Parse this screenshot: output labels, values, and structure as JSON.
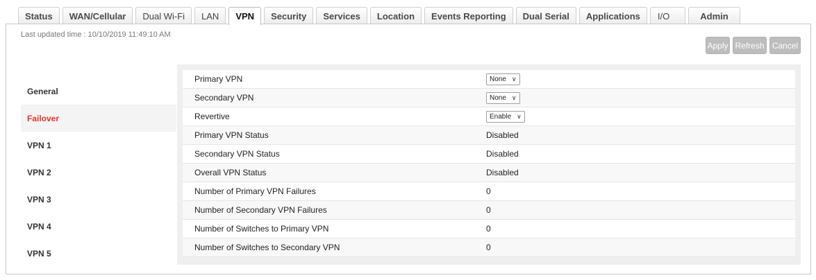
{
  "tabs": [
    {
      "label": "Status",
      "key": "status"
    },
    {
      "label": "WAN/Cellular",
      "key": "wan"
    },
    {
      "label": "Dual Wi-Fi",
      "key": "wifi"
    },
    {
      "label": "LAN",
      "key": "lan"
    },
    {
      "label": "VPN",
      "key": "vpn"
    },
    {
      "label": "Security",
      "key": "security"
    },
    {
      "label": "Services",
      "key": "services"
    },
    {
      "label": "Location",
      "key": "location"
    },
    {
      "label": "Events Reporting",
      "key": "events"
    },
    {
      "label": "Dual Serial",
      "key": "serial"
    },
    {
      "label": "Applications",
      "key": "apps"
    },
    {
      "label": "I/O",
      "key": "io"
    },
    {
      "label": "Admin",
      "key": "admin"
    }
  ],
  "active_tab": "VPN",
  "header": {
    "last_updated_label": "Last updated time :",
    "last_updated_value": "10/10/2019 11:49:10 AM"
  },
  "buttons": {
    "apply": "Apply",
    "refresh": "Refresh",
    "cancel": "Cancel"
  },
  "sidebar": {
    "items": [
      "General",
      "Failover",
      "VPN 1",
      "VPN 2",
      "VPN 3",
      "VPN 4",
      "VPN 5"
    ],
    "active": "Failover"
  },
  "form": {
    "rows": [
      {
        "label": "Primary VPN",
        "type": "select",
        "value": "None"
      },
      {
        "label": "Secondary VPN",
        "type": "select",
        "value": "None"
      },
      {
        "label": "Revertive",
        "type": "select",
        "value": "Enable"
      },
      {
        "label": "Primary VPN Status",
        "type": "text",
        "value": "Disabled"
      },
      {
        "label": "Secondary VPN Status",
        "type": "text",
        "value": "Disabled"
      },
      {
        "label": "Overall VPN Status",
        "type": "text",
        "value": "Disabled"
      },
      {
        "label": "Number of Primary VPN Failures",
        "type": "text",
        "value": "0"
      },
      {
        "label": "Number of Secondary VPN Failures",
        "type": "text",
        "value": "0"
      },
      {
        "label": "Number of Switches to Primary VPN",
        "type": "text",
        "value": "0"
      },
      {
        "label": "Number of Switches to Secondary VPN",
        "type": "text",
        "value": "0"
      }
    ]
  },
  "colors": {
    "active_nav": "#e8342b",
    "button_disabled": "#bdbdbd",
    "content_bg": "#efefef"
  }
}
